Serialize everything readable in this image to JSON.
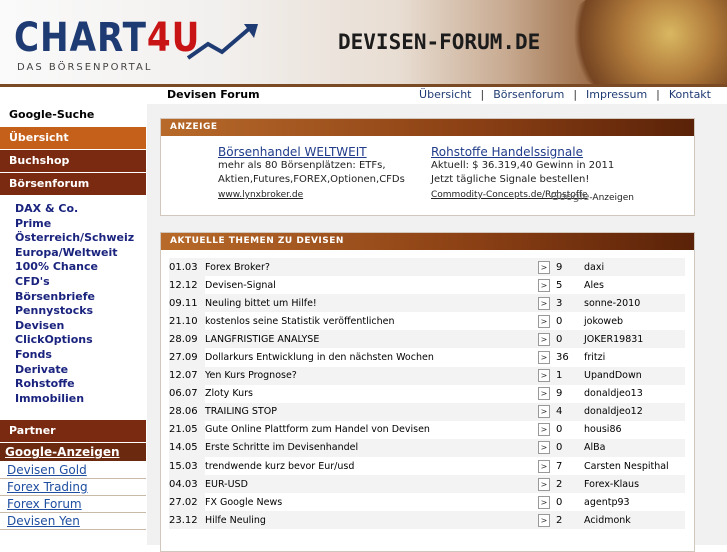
{
  "header": {
    "logo_main": "CHART",
    "logo_four": "4U",
    "logo_sub": "DAS BÖRSENPORTAL",
    "site_title": "DEVISEN-FORUM.DE"
  },
  "topbar": {
    "title": "Devisen Forum",
    "links": [
      "Übersicht",
      "Börsenforum",
      "Impressum",
      "Kontakt"
    ]
  },
  "nav": {
    "google": "Google-Suche",
    "items": [
      "Übersicht",
      "Buchshop",
      "Börsenforum"
    ],
    "links": [
      "DAX & Co.",
      "Prime",
      "Österreich/Schweiz",
      "Europa/Weltweit",
      "100% Chance",
      "CFD's",
      "Börsenbriefe",
      "Pennystocks",
      "Devisen",
      "ClickOptions",
      "Fonds",
      "Derivate",
      "Rohstoffe",
      "Immobilien"
    ],
    "partner": "Partner",
    "ads_head": "Google-Anzeigen",
    "ads_links": [
      "Devisen Gold",
      "Forex Trading",
      "Forex Forum",
      "Devisen Yen"
    ]
  },
  "ad_panel": {
    "head": "ANZEIGE",
    "ad1": {
      "title": "Börsenhandel WELTWEIT",
      "line1": "mehr als 80 Börsenplätzen: ETFs,",
      "line2": "Aktien,Futures,FOREX,Optionen,CFDs",
      "url": "www.lynxbroker.de"
    },
    "ad2": {
      "title": "Rohstoffe Handelssignale",
      "line1": "Aktuell: $ 36.319,40 Gewinn in 2011",
      "line2": "Jetzt tägliche Signale bestellen!",
      "url": "Commodity-Concepts.de/Rohstoffe"
    },
    "google_brand": "Google",
    "google_suffix": "-Anzeigen"
  },
  "topics": {
    "head": "AKTUELLE THEMEN ZU DEVISEN",
    "arrow": ">",
    "rows": [
      {
        "date": "01.03",
        "title": "Forex Broker?",
        "count": "9",
        "user": "daxi"
      },
      {
        "date": "12.12",
        "title": "Devisen-Signal",
        "count": "5",
        "user": "Ales"
      },
      {
        "date": "09.11",
        "title": "Neuling bittet um Hilfe!",
        "count": "3",
        "user": "sonne-2010"
      },
      {
        "date": "21.10",
        "title": "kostenlos seine Statistik veröffentlichen",
        "count": "0",
        "user": "jokoweb"
      },
      {
        "date": "28.09",
        "title": "LANGFRISTIGE ANALYSE",
        "count": "0",
        "user": "JOKER19831"
      },
      {
        "date": "27.09",
        "title": "Dollarkurs Entwicklung in den nächsten Wochen",
        "count": "36",
        "user": "fritzi"
      },
      {
        "date": "12.07",
        "title": "Yen Kurs Prognose?",
        "count": "1",
        "user": "UpandDown"
      },
      {
        "date": "06.07",
        "title": "Zloty Kurs",
        "count": "9",
        "user": "donaldjeo13"
      },
      {
        "date": "28.06",
        "title": "TRAILING STOP",
        "count": "4",
        "user": "donaldjeo12"
      },
      {
        "date": "21.05",
        "title": "Gute Online Plattform zum Handel von Devisen",
        "count": "0",
        "user": "housi86"
      },
      {
        "date": "14.05",
        "title": "Erste Schritte im Devisenhandel",
        "count": "0",
        "user": "AlBa"
      },
      {
        "date": "15.03",
        "title": "trendwende kurz bevor Eur/usd",
        "count": "7",
        "user": "Carsten Nespithal"
      },
      {
        "date": "04.03",
        "title": "EUR-USD",
        "count": "2",
        "user": "Forex-Klaus"
      },
      {
        "date": "27.02",
        "title": "FX Google News",
        "count": "0",
        "user": "agentp93"
      },
      {
        "date": "23.12",
        "title": "Hilfe Neuling",
        "count": "2",
        "user": "Acidmonk"
      }
    ]
  },
  "colors": {
    "nav_bg": "#7a2a10",
    "nav_active": "#c4601a",
    "link_blue": "#1a237e",
    "panel_head": "#8a3f14"
  }
}
